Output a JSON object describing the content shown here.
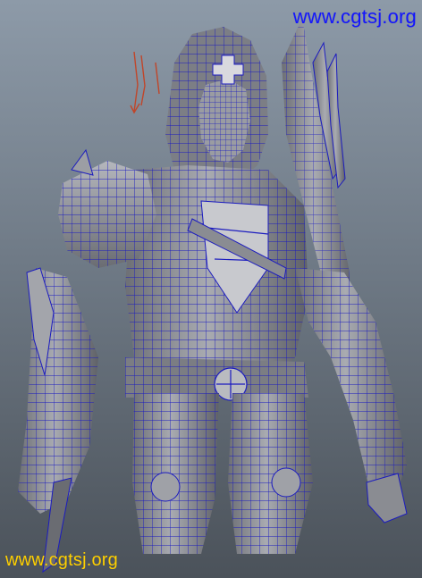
{
  "watermarks": {
    "top": "www.cgtsj.org",
    "bottom": "www.cgtsj.org"
  },
  "colors": {
    "background_top": "#8d9aa8",
    "background_bottom": "#4b525a",
    "wireframe": "#1b1bbf",
    "shaded_surface": "#8e9096",
    "highlight": "#e6e6e9",
    "watermark_top": "#1416ff",
    "watermark_bottom": "#ffd000",
    "pivot_marker": "#c0462a"
  }
}
